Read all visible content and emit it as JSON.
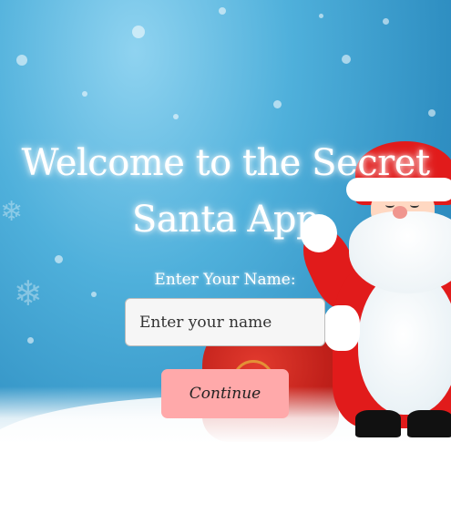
{
  "welcome": {
    "title": "Welcome to the Secret Santa App"
  },
  "form": {
    "name_label": "Enter Your Name:",
    "name_placeholder": "Enter your name",
    "name_value": "",
    "continue_label": "Continue"
  },
  "colors": {
    "sky": "#4fb0db",
    "button": "#ffa9aa",
    "input_bg": "#f6f6f6",
    "santa_red": "#e11b1b"
  },
  "icons": [
    "santa-illustration",
    "gift-bag-illustration",
    "snowflake-icon"
  ]
}
